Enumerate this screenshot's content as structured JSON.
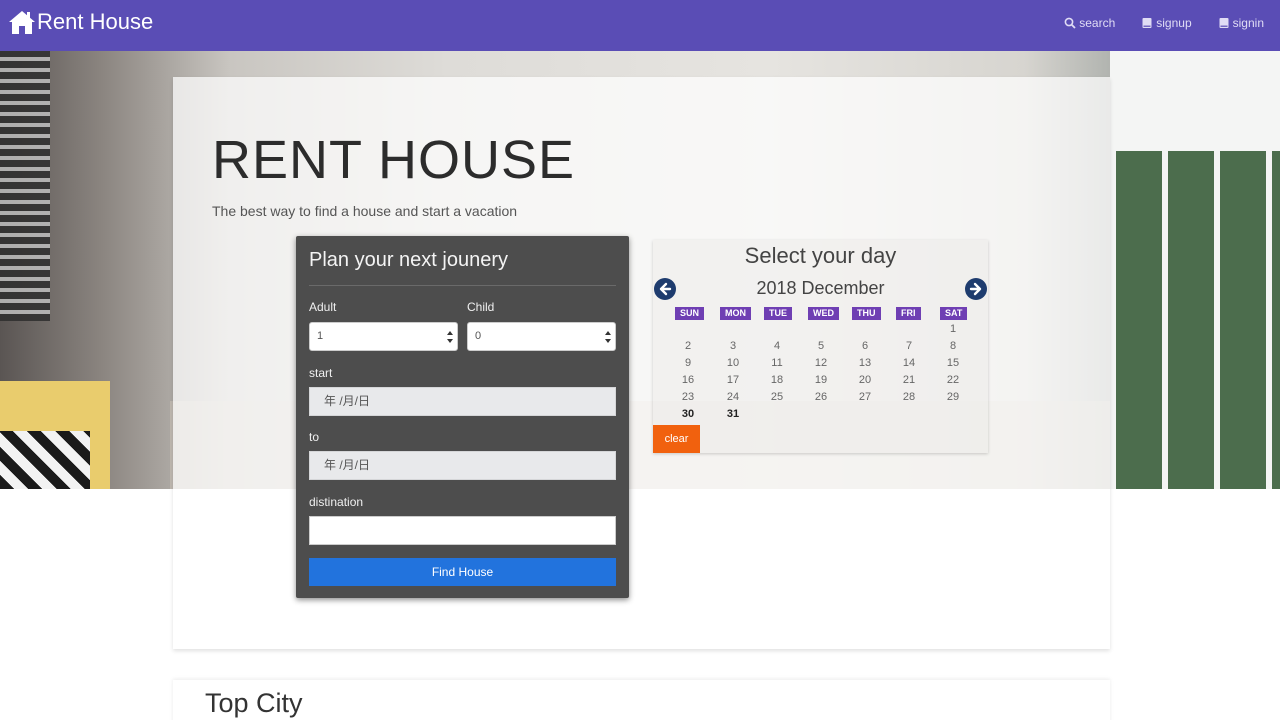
{
  "navbar": {
    "brand": "Rent House",
    "links": [
      {
        "label": "search",
        "icon": "search-icon"
      },
      {
        "label": "signup",
        "icon": "book-icon"
      },
      {
        "label": "signin",
        "icon": "book-icon"
      }
    ],
    "background_color": "#5a4db5"
  },
  "hero": {
    "title": "RENT HOUSE",
    "subtitle": "The best way to find a house and start a vacation"
  },
  "form": {
    "title": "Plan your next jounery",
    "adult_label": "Adult",
    "adult_value": "1",
    "child_label": "Child",
    "child_value": "0",
    "start_label": "start",
    "start_value": "年 /月/日",
    "to_label": "to",
    "to_value": "年 /月/日",
    "destination_label": "distination",
    "destination_value": "",
    "submit_label": "Find House",
    "submit_color": "#2273dd"
  },
  "calendar": {
    "title": "Select your day",
    "month": "2018 December",
    "weekdays": [
      "SUN",
      "MON",
      "TUE",
      "WED",
      "THU",
      "FRI",
      "SAT"
    ],
    "weekday_color": "#6f3fb3",
    "weeks": [
      [
        "",
        "",
        "",
        "",
        "",
        "",
        "1"
      ],
      [
        "2",
        "3",
        "4",
        "5",
        "6",
        "7",
        "8"
      ],
      [
        "9",
        "10",
        "11",
        "12",
        "13",
        "14",
        "15"
      ],
      [
        "16",
        "17",
        "18",
        "19",
        "20",
        "21",
        "22"
      ],
      [
        "23",
        "24",
        "25",
        "26",
        "27",
        "28",
        "29"
      ],
      [
        "30",
        "31",
        "",
        "",
        "",
        "",
        ""
      ]
    ],
    "clear_label": "clear",
    "clear_color": "#f1610e"
  },
  "top_city": {
    "title": "Top City"
  }
}
